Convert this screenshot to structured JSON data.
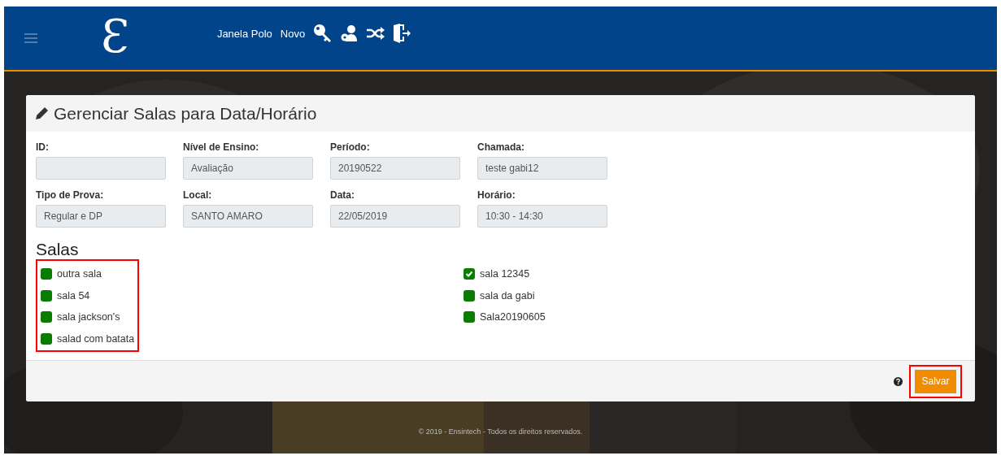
{
  "header": {
    "logo": "Ɛ",
    "nav": [
      "Janela Polo",
      "Novo"
    ]
  },
  "card": {
    "title": "Gerenciar Salas para Data/Horário",
    "fields": [
      {
        "label": "ID:"
      },
      {
        "label": "Nível de Ensino:",
        "value": "Avaliação"
      },
      {
        "label": "Período:",
        "value": "20190522"
      },
      {
        "label": "Chamada:",
        "value": "teste gabi12"
      },
      {
        "label": "Tipo de Prova:",
        "value": "Regular e DP"
      },
      {
        "label": "Local:",
        "value": "SANTO AMARO"
      },
      {
        "label": "Data:",
        "value": "22/05/2019"
      },
      {
        "label": "Horário:",
        "value": "10:30 - 14:30"
      }
    ],
    "salas": {
      "heading": "Salas",
      "columns": [
        {
          "highlighted": true,
          "items": [
            {
              "label": "outra sala",
              "checked": false
            },
            {
              "label": "sala 54",
              "checked": false
            },
            {
              "label": "sala jackson's",
              "checked": false
            },
            {
              "label": "salad com batata",
              "checked": false
            }
          ]
        },
        {
          "highlighted": false,
          "items": [
            {
              "label": "sala 12345",
              "checked": true
            },
            {
              "label": "sala da gabi",
              "checked": false
            },
            {
              "label": "Sala20190605",
              "checked": false
            }
          ]
        }
      ]
    },
    "save_button": {
      "label": "Salvar",
      "highlighted": true
    }
  },
  "copyright": "© 2019 - Ensintech - Todos os direitos reservados."
}
